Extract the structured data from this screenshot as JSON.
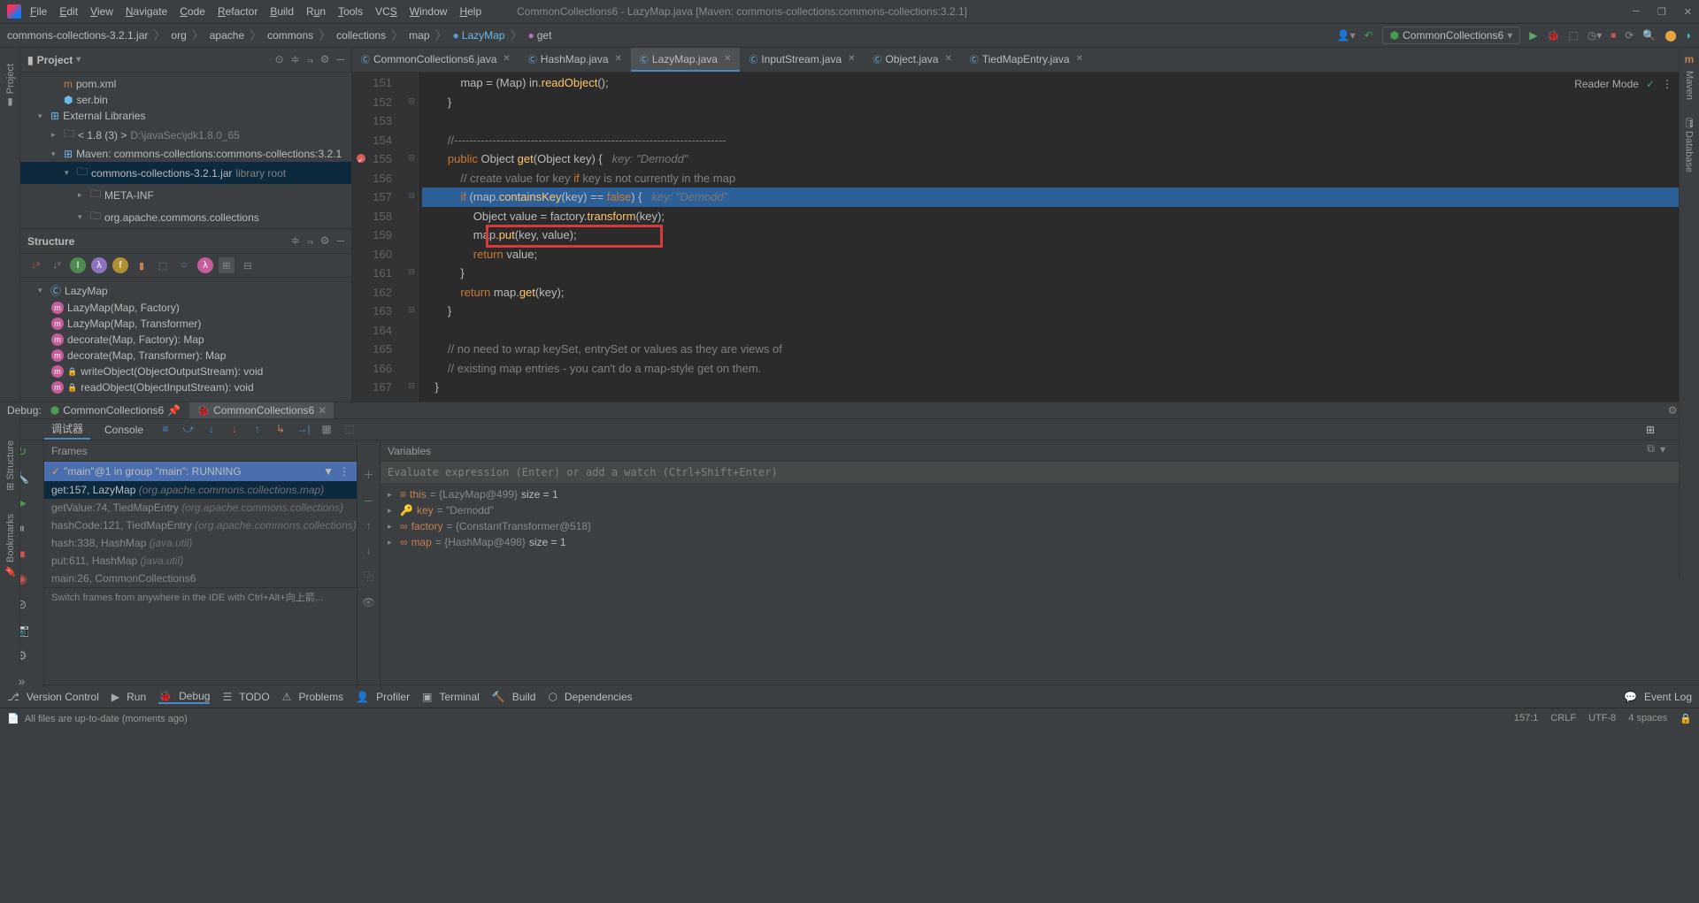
{
  "menu": [
    "File",
    "Edit",
    "View",
    "Navigate",
    "Code",
    "Refactor",
    "Build",
    "Run",
    "Tools",
    "VCS",
    "Window",
    "Help"
  ],
  "title": "CommonCollections6 - LazyMap.java [Maven: commons-collections:commons-collections:3.2.1]",
  "breadcrumb": {
    "root": "commons-collections-3.2.1.jar",
    "parts": [
      "org",
      "apache",
      "commons",
      "collections",
      "map"
    ],
    "cls": "LazyMap",
    "method": "get"
  },
  "runconfig": "CommonCollections6",
  "project": {
    "header": "Project",
    "items": [
      {
        "l": 1,
        "ic": "pom",
        "label": "pom.xml"
      },
      {
        "l": 1,
        "ic": "bin",
        "label": "ser.bin"
      },
      {
        "l": 0,
        "arr": "▾",
        "ic": "lib",
        "label": "External Libraries"
      },
      {
        "l": 1,
        "arr": "▸",
        "ic": "dir",
        "label": "< 1.8 (3) >",
        "tail": "D:\\javaSec\\jdk1.8.0_65"
      },
      {
        "l": 1,
        "arr": "▾",
        "ic": "lib",
        "label": "Maven: commons-collections:commons-collections:3.2.1"
      },
      {
        "l": 2,
        "arr": "▾",
        "ic": "dir",
        "label": "commons-collections-3.2.1.jar",
        "tail": "library root",
        "sel": true
      },
      {
        "l": 3,
        "arr": "▸",
        "ic": "dir",
        "label": "META-INF"
      },
      {
        "l": 3,
        "arr": "▾",
        "ic": "dir",
        "label": "org.apache.commons.collections"
      }
    ]
  },
  "structure": {
    "header": "Structure",
    "root": "LazyMap",
    "items": [
      {
        "ic": "m",
        "label": "LazyMap(Map, Factory)"
      },
      {
        "ic": "m",
        "label": "LazyMap(Map, Transformer)"
      },
      {
        "ic": "m",
        "label": "decorate(Map, Factory): Map"
      },
      {
        "ic": "m",
        "label": "decorate(Map, Transformer): Map"
      },
      {
        "ic": "m",
        "lock": true,
        "label": "writeObject(ObjectOutputStream): void"
      },
      {
        "ic": "m",
        "lock": true,
        "label": "readObject(ObjectInputStream): void"
      }
    ]
  },
  "tabs": [
    {
      "name": "CommonCollections6.java",
      "active": false
    },
    {
      "name": "HashMap.java",
      "active": false
    },
    {
      "name": "LazyMap.java",
      "active": true
    },
    {
      "name": "InputStream.java",
      "active": false
    },
    {
      "name": "Object.java",
      "active": false
    },
    {
      "name": "TiedMapEntry.java",
      "active": false
    }
  ],
  "reader": "Reader Mode",
  "code": {
    "start": 151,
    "lines": [
      "            map = (Map) in.readObject();",
      "        }",
      "",
      "        //-----------------------------------------------------------------------",
      "        public Object get(Object key) {   key: \"Demodd\"",
      "            // create value for key if key is not currently in the map",
      "            if (map.containsKey(key) == false) {   key: \"Demodd\"",
      "                Object value = factory.transform(key);",
      "                map.put(key, value);",
      "                return value;",
      "            }",
      "            return map.get(key);",
      "        }",
      "",
      "        // no need to wrap keySet, entrySet or values as they are views of",
      "        // existing map entries - you can't do a map-style get on them.",
      "    }"
    ],
    "hl": 157,
    "bp": 155
  },
  "debug": {
    "label": "Debug:",
    "config": "CommonCollections6",
    "runtab": "CommonCollections6",
    "tab1": "调试器",
    "tab2": "Console",
    "frames_h": "Frames",
    "vars_h": "Variables",
    "thread": "\"main\"@1 in group \"main\": RUNNING",
    "frames": [
      {
        "txt": "get:157, LazyMap",
        "pkg": "(org.apache.commons.collections.map)",
        "sel": true
      },
      {
        "txt": "getValue:74, TiedMapEntry",
        "pkg": "(org.apache.commons.collections)"
      },
      {
        "txt": "hashCode:121, TiedMapEntry",
        "pkg": "(org.apache.commons.collections)"
      },
      {
        "txt": "hash:338, HashMap",
        "pkg": "(java.util)"
      },
      {
        "txt": "put:611, HashMap",
        "pkg": "(java.util)"
      },
      {
        "txt": "main:26, CommonCollections6",
        "pkg": ""
      }
    ],
    "eval": "Evaluate expression (Enter) or add a watch (Ctrl+Shift+Enter)",
    "vars": [
      {
        "name": "this",
        "val": "= {LazyMap@499}",
        "extra": "size = 1",
        "ic": "≡"
      },
      {
        "name": "key",
        "val": "= \"Demodd\"",
        "ic": "🔑"
      },
      {
        "name": "factory",
        "val": "= {ConstantTransformer@518}",
        "ic": "∞"
      },
      {
        "name": "map",
        "val": "= {HashMap@498}",
        "extra": "size = 1",
        "ic": "∞"
      }
    ],
    "hint": "Switch frames from anywhere in the IDE with Ctrl+Alt+向上箭..."
  },
  "bottom": [
    {
      "ic": "⎇",
      "label": "Version Control"
    },
    {
      "ic": "▶",
      "label": "Run"
    },
    {
      "ic": "🐞",
      "label": "Debug",
      "active": true
    },
    {
      "ic": "☰",
      "label": "TODO"
    },
    {
      "ic": "⚠",
      "label": "Problems"
    },
    {
      "ic": "👤",
      "label": "Profiler"
    },
    {
      "ic": "▣",
      "label": "Terminal"
    },
    {
      "ic": "🔨",
      "label": "Build"
    },
    {
      "ic": "⬡",
      "label": "Dependencies"
    }
  ],
  "eventlog": "Event Log",
  "status": {
    "msg": "All files are up-to-date (moments ago)",
    "pos": "157:1",
    "eol": "CRLF",
    "enc": "UTF-8",
    "ind": "4 spaces"
  }
}
